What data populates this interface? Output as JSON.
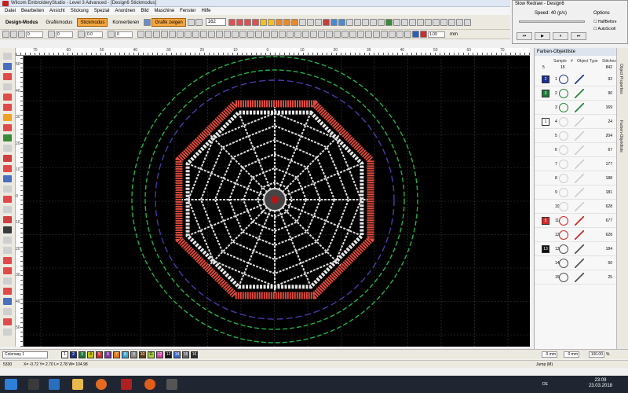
{
  "window": {
    "title": "Wilcom EmbroideryStudio - Level 3 Advanced - [Design6     Stickmodus]"
  },
  "menu": [
    "Datei",
    "Bearbeiten",
    "Ansicht",
    "Stickung",
    "Spezial",
    "Anordnen",
    "Bild",
    "Maschine",
    "Fenster",
    "Hilfe"
  ],
  "mode_bar": {
    "items": [
      "Design-Modus",
      "Grafikmodus",
      "Stickmodus",
      "Konvertieren"
    ],
    "active": "Stickmodus",
    "show_graphic": "Grafik zeigen",
    "zoom": "162"
  },
  "toolbar2": {
    "stitch_length": "1.00",
    "unit": "mm",
    "fields": [
      "0",
      "0",
      "0.0",
      "0"
    ]
  },
  "ruler": {
    "top_labels": [
      "70",
      "60",
      "50",
      "40",
      "30",
      "20",
      "10",
      "0",
      "10",
      "20",
      "30",
      "40",
      "50",
      "60",
      "70"
    ],
    "left_labels": [
      "50",
      "40",
      "30",
      "20",
      "10",
      "0",
      "10",
      "20",
      "30",
      "40",
      "50"
    ]
  },
  "panel": {
    "title": "Farben-Objektliste",
    "columns": {
      "sample": "Sample",
      "num": "#",
      "type": "Object Type",
      "stitches": "Stitches"
    },
    "summary": {
      "a": "5",
      "b": "15",
      "stitches": "842"
    },
    "rows": [
      {
        "swatch": "2",
        "color": "#1c2d8c",
        "num": "1",
        "stitches": "92",
        "ring": "#2a3a9a"
      },
      {
        "swatch": "3",
        "color": "#1e7a3a",
        "num": "2",
        "stitches": "90",
        "ring": "#2a8a3a"
      },
      {
        "swatch": "",
        "color": "",
        "num": "3",
        "stitches": "169",
        "ring": "#2a8a3a"
      },
      {
        "swatch": "1",
        "color": "#ffffff",
        "num": "4",
        "stitches": "24",
        "ring": "#cfcfcf"
      },
      {
        "swatch": "",
        "color": "",
        "num": "5",
        "stitches": "204",
        "ring": "#cfcfcf"
      },
      {
        "swatch": "",
        "color": "",
        "num": "6",
        "stitches": "67",
        "ring": "#cfcfcf"
      },
      {
        "swatch": "",
        "color": "",
        "num": "7",
        "stitches": "177",
        "ring": "#cfcfcf"
      },
      {
        "swatch": "",
        "color": "",
        "num": "8",
        "stitches": "188",
        "ring": "#cfcfcf"
      },
      {
        "swatch": "",
        "color": "",
        "num": "9",
        "stitches": "181",
        "ring": "#cfcfcf"
      },
      {
        "swatch": "",
        "color": "",
        "num": "10",
        "stitches": "628",
        "ring": "#cfcfcf"
      },
      {
        "swatch": "5",
        "color": "#d42a2a",
        "num": "11",
        "stitches": "677",
        "ring": "#d42a2a"
      },
      {
        "swatch": "",
        "color": "",
        "num": "12",
        "stitches": "628",
        "ring": "#d42a2a"
      },
      {
        "swatch": "13",
        "color": "#111111",
        "num": "13",
        "stitches": "184",
        "ring": "#555555"
      },
      {
        "swatch": "",
        "color": "",
        "num": "14",
        "stitches": "50",
        "ring": "#555555"
      },
      {
        "swatch": "",
        "color": "",
        "num": "15",
        "stitches": "25",
        "ring": "#555555"
      }
    ]
  },
  "vtabs": [
    "Object Properties",
    "Farben-Objektliste"
  ],
  "redraw": {
    "title": "Slow Redraw - Design6",
    "speed_label": "Speed:",
    "speed_value": "40 (p/s)",
    "options": "Options",
    "opt1": "HalfBefore",
    "opt2": "AutoScroll"
  },
  "colorway": {
    "name": "Colorway 1",
    "swatches": [
      "1",
      "2",
      "3",
      "4",
      "5",
      "6",
      "7",
      "8",
      "9",
      "10",
      "11",
      "12",
      "13",
      "14",
      "15",
      "16"
    ]
  },
  "fields_bottom": {
    "w": "0 mm",
    "h": "0 mm",
    "pw": "100.00",
    "ph": "100.00",
    "units": "%"
  },
  "status": {
    "stitches": "5330",
    "coords": "X= -0.72 Y= 2.70 L= 2.78 W= 104.98",
    "mode": "Jump (M)"
  },
  "taskbar": {
    "lang": "DE",
    "time": "23:09",
    "date": "23.03.2018"
  },
  "colors": {
    "canvas": "#000000",
    "accent": "#f5a640",
    "red_stitch": "#e24b3e",
    "green_ring": "#22b24a",
    "purple_ring": "#4a3aa8"
  }
}
